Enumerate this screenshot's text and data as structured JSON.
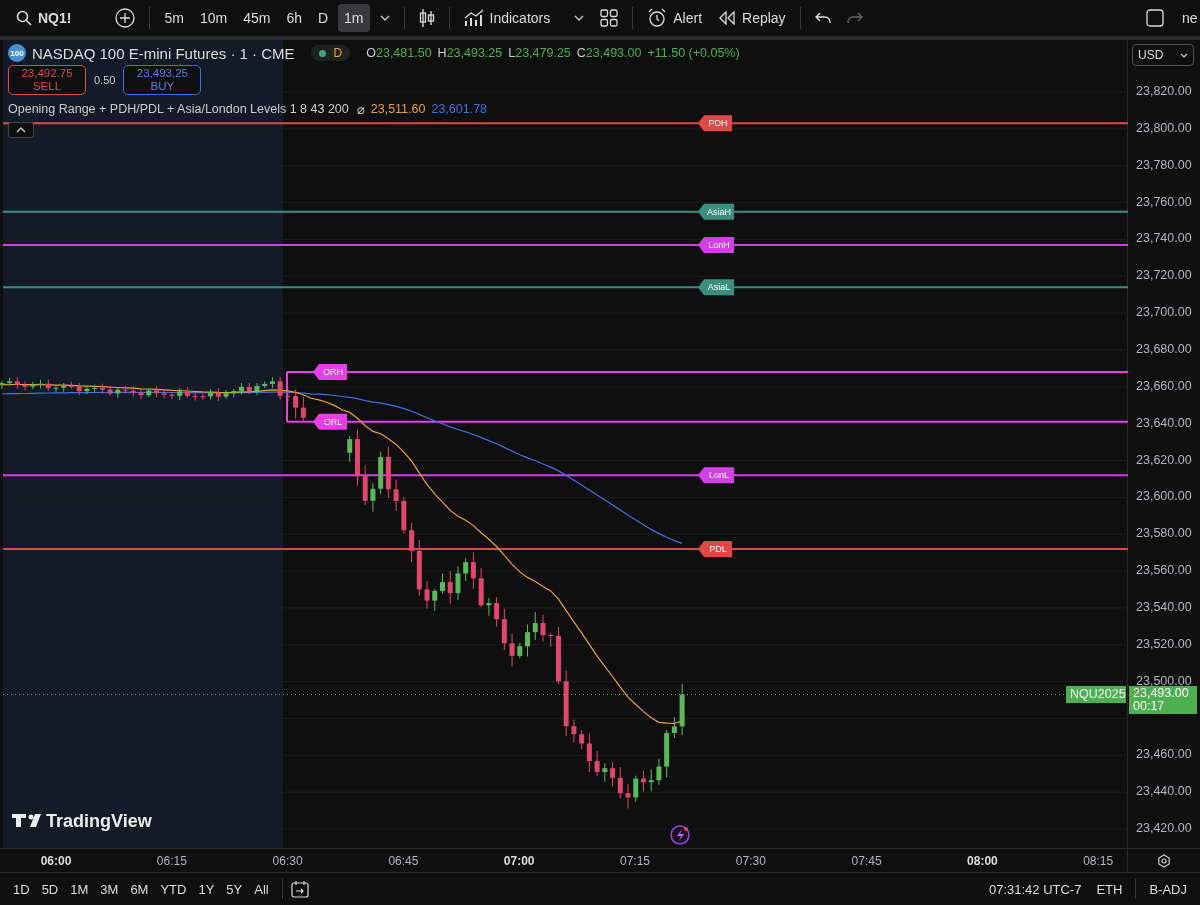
{
  "toolbar": {
    "symbol": "NQ1!",
    "intervals": [
      {
        "label": "5m",
        "selected": false
      },
      {
        "label": "10m",
        "selected": false
      },
      {
        "label": "45m",
        "selected": false
      },
      {
        "label": "6h",
        "selected": false
      },
      {
        "label": "D",
        "selected": false
      },
      {
        "label": "1m",
        "selected": true
      }
    ],
    "indicators": "Indicators",
    "alert": "Alert",
    "replay": "Replay",
    "redo_disabled": true,
    "cut_text": "ne"
  },
  "legend": {
    "logo": "100",
    "title": "NASDAQ 100 E-mini Futures · 1 · CME",
    "session": "D",
    "ohlc": [
      {
        "key": "O",
        "value": "23,481.50"
      },
      {
        "key": "H",
        "value": "23,493.25"
      },
      {
        "key": "L",
        "value": "23,479.25"
      },
      {
        "key": "C",
        "value": "23,493.00"
      }
    ],
    "change": "+11.50 (+0.05%)",
    "sell": {
      "price": "23,492.75",
      "label": "SELL"
    },
    "spread": "0.50",
    "buy": {
      "price": "23,493.25",
      "label": "BUY"
    },
    "indicator": {
      "name": "Opening Range + PDH/PDL + Asia/London Levels 1 8 43 200",
      "symbol": "⌀",
      "values": [
        {
          "text": "23,511.60",
          "color": "#f0a030"
        },
        {
          "text": "23,601.78",
          "color": "#3f6fe0"
        }
      ]
    }
  },
  "levels": [
    {
      "label": "PDH",
      "color": "#e04848"
    },
    {
      "label": "AsiaH",
      "color": "#3a8f80"
    },
    {
      "label": "LonH",
      "color": "#d23fe6"
    },
    {
      "label": "AsiaL",
      "color": "#3a8f80"
    },
    {
      "label": "ORH",
      "color": "#e83ee8"
    },
    {
      "label": "ORL",
      "color": "#e83ee8"
    },
    {
      "label": "LonL",
      "color": "#d23fe6"
    },
    {
      "label": "PDL",
      "color": "#e04848"
    }
  ],
  "brand": "TradingView",
  "price_axis": {
    "currency": "USD",
    "labels": [
      "23,820.00",
      "23,800.00",
      "23,780.00",
      "23,760.00",
      "23,740.00",
      "23,720.00",
      "23,700.00",
      "23,680.00",
      "23,660.00",
      "23,640.00",
      "23,620.00",
      "23,600.00",
      "23,580.00",
      "23,560.00",
      "23,540.00",
      "23,520.00",
      "23,500.00",
      "23,460.00",
      "23,440.00",
      "23,420.00"
    ],
    "symbol_tag": "NQU2025",
    "last_price": "23,493.00",
    "countdown": "00:17"
  },
  "time_axis": {
    "labels": [
      {
        "text": "06:00",
        "bold": true
      },
      {
        "text": "06:15",
        "bold": false
      },
      {
        "text": "06:30",
        "bold": false
      },
      {
        "text": "06:45",
        "bold": false
      },
      {
        "text": "07:00",
        "bold": true
      },
      {
        "text": "07:15",
        "bold": false
      },
      {
        "text": "07:30",
        "bold": false
      },
      {
        "text": "07:45",
        "bold": false
      },
      {
        "text": "08:00",
        "bold": true
      },
      {
        "text": "08:15",
        "bold": false
      }
    ]
  },
  "bottom_bar": {
    "ranges": [
      "1D",
      "5D",
      "1M",
      "3M",
      "6M",
      "YTD",
      "1Y",
      "5Y",
      "All"
    ],
    "clock": "07:31:42 UTC-7",
    "session": "ETH",
    "adjust": "B-ADJ"
  }
}
